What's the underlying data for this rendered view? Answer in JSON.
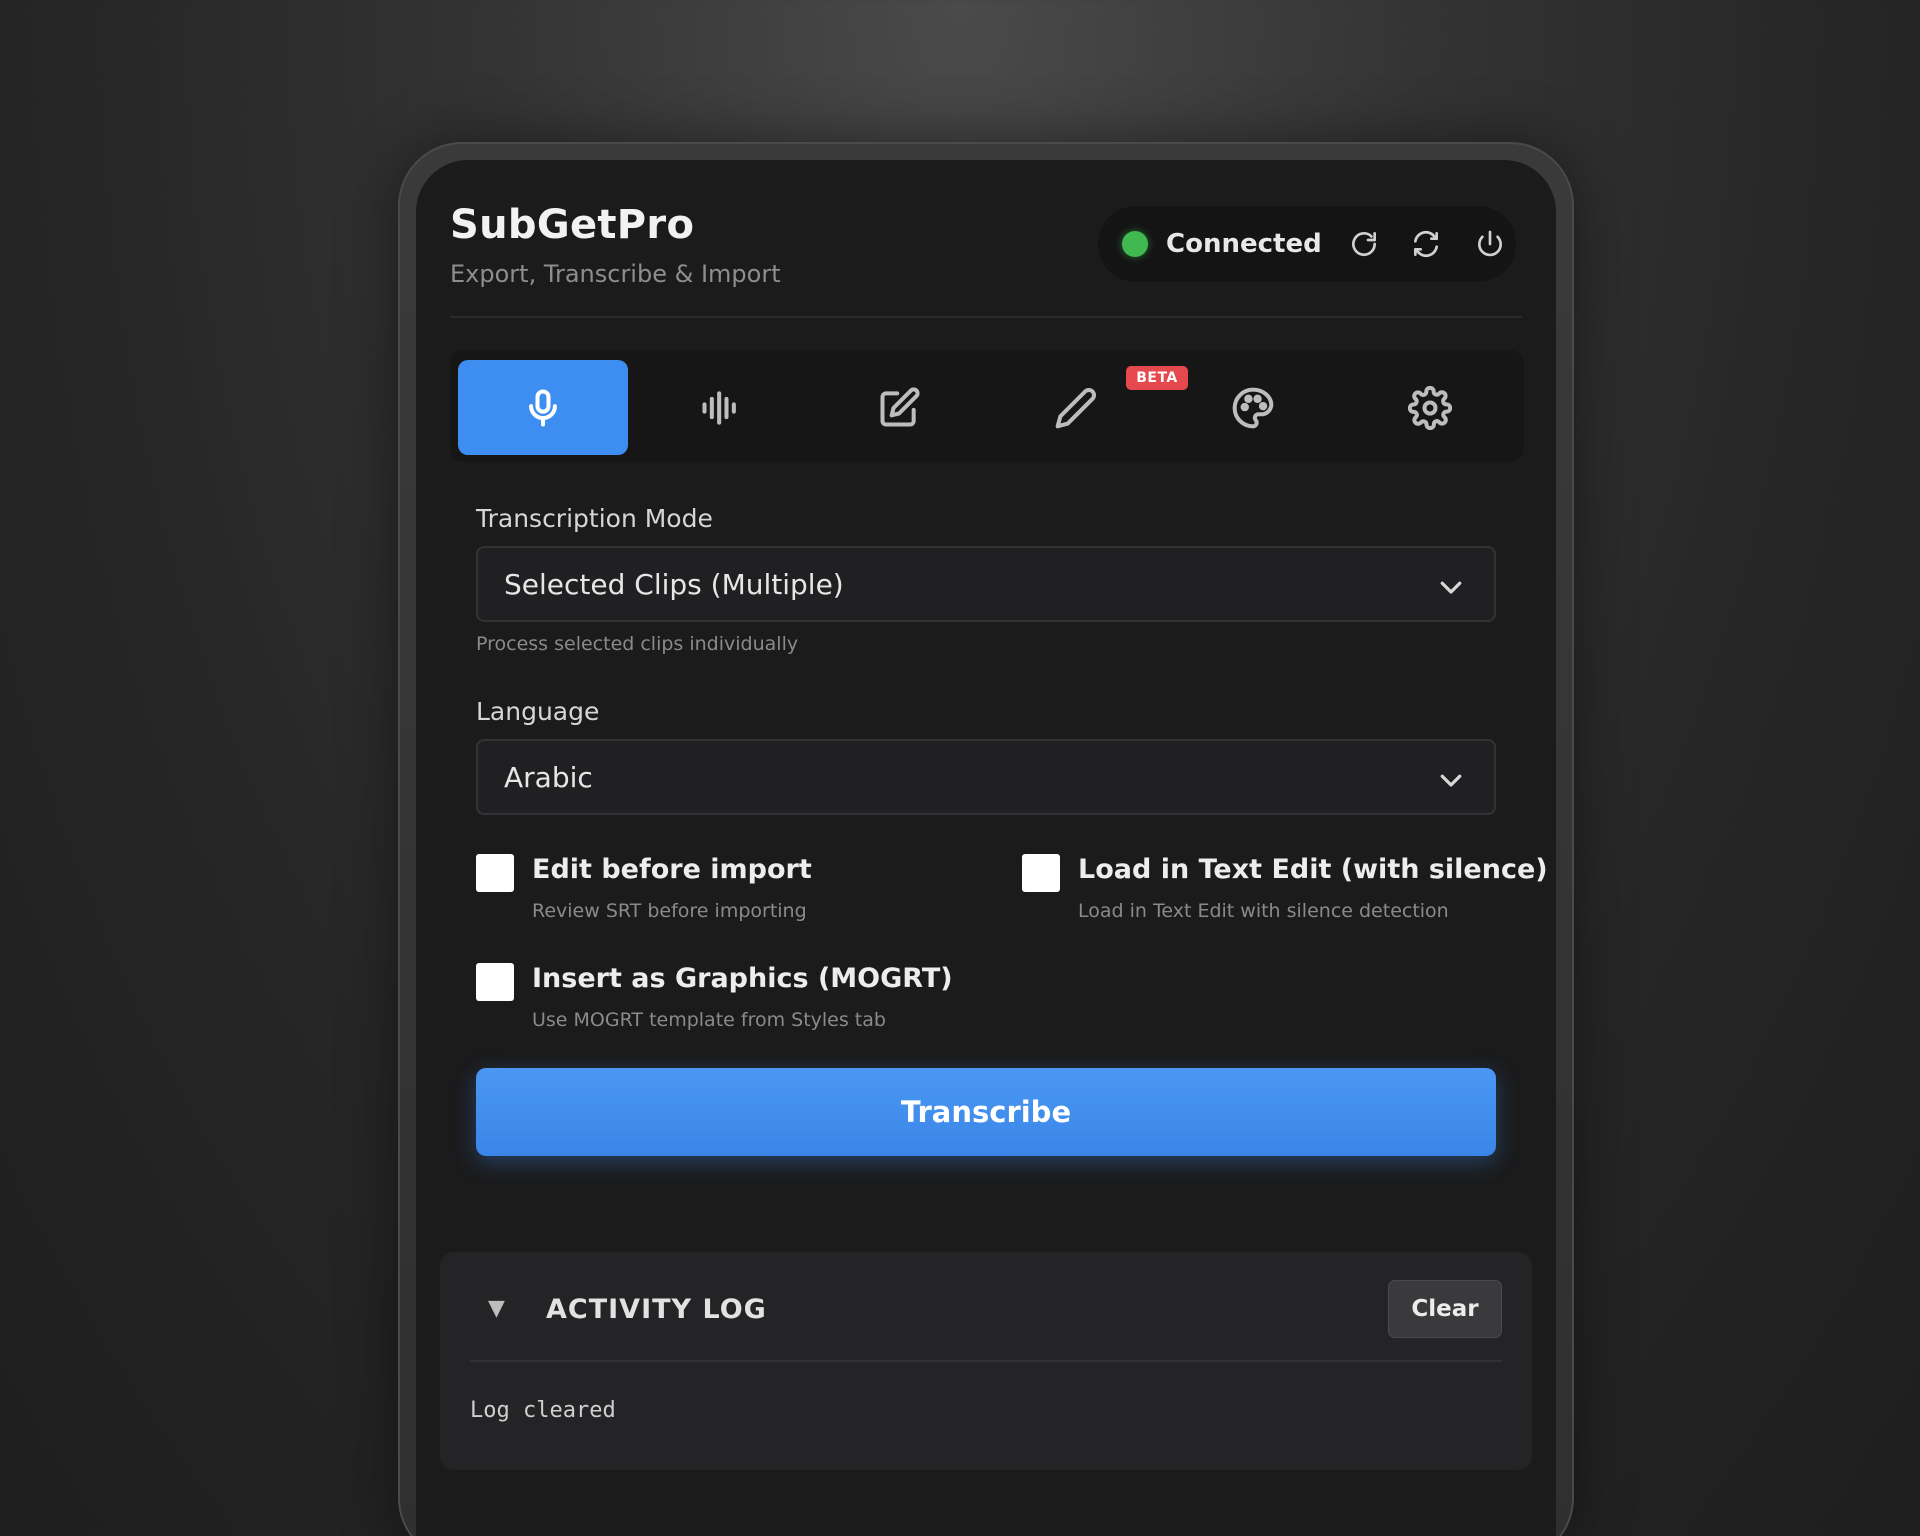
{
  "app": {
    "title": "SubGetPro",
    "subtitle": "Export, Transcribe & Import"
  },
  "status": {
    "text": "Connected",
    "color": "#3fb950"
  },
  "tabs": [
    {
      "icon": "microphone-icon",
      "active": true
    },
    {
      "icon": "waveform-icon",
      "active": false
    },
    {
      "icon": "edit-square-icon",
      "active": false
    },
    {
      "icon": "pencil-icon",
      "active": false,
      "badge": "BETA"
    },
    {
      "icon": "palette-icon",
      "active": false
    },
    {
      "icon": "gear-icon",
      "active": false
    }
  ],
  "form": {
    "mode": {
      "label": "Transcription Mode",
      "value": "Selected Clips (Multiple)",
      "helper": "Process selected clips individually"
    },
    "language": {
      "label": "Language",
      "value": "Arabic"
    },
    "options": [
      {
        "label": "Edit before import",
        "desc": "Review SRT before importing",
        "checked": false
      },
      {
        "label": "Load in Text Edit (with silence)",
        "desc": "Load in Text Edit with silence detection",
        "checked": false
      },
      {
        "label": "Insert as Graphics (MOGRT)",
        "desc": "Use MOGRT template from Styles tab",
        "checked": false
      }
    ],
    "submit_label": "Transcribe"
  },
  "log": {
    "toggle": "▼",
    "title": "ACTIVITY LOG",
    "clear_label": "Clear",
    "lines": [
      "Log cleared"
    ]
  },
  "colors": {
    "accent": "#3d8ef0",
    "badge": "#e5484d"
  }
}
